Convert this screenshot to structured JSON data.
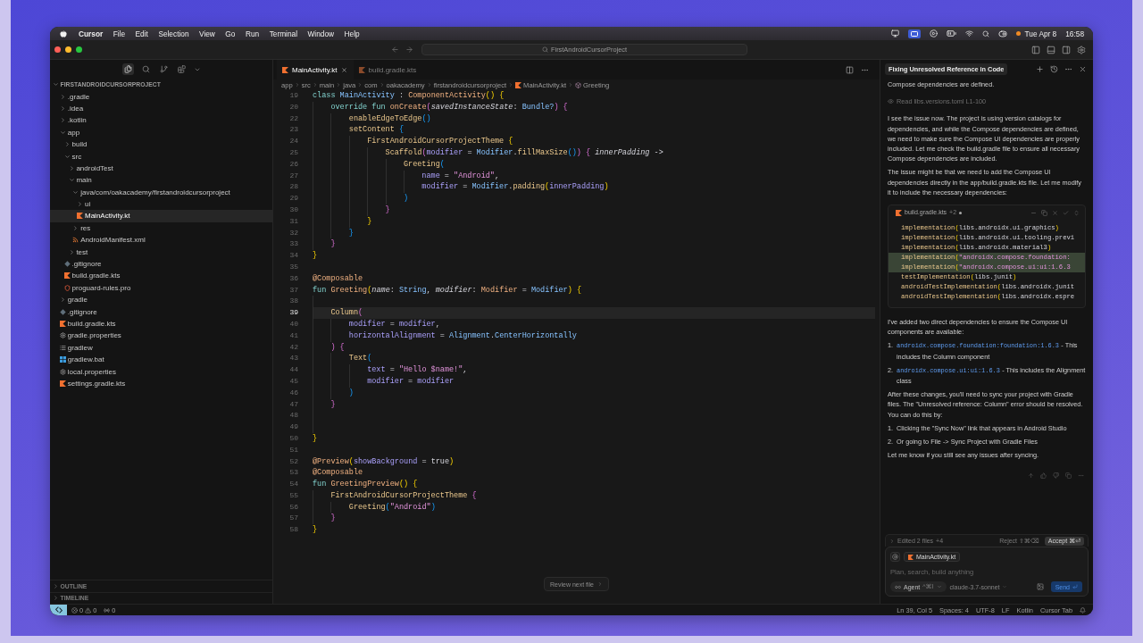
{
  "menu_bar": {
    "app_name": "Cursor",
    "menus": [
      "File",
      "Edit",
      "Selection",
      "View",
      "Go",
      "Run",
      "Terminal",
      "Window",
      "Help"
    ],
    "date": "Tue Apr 8",
    "time": "16:58"
  },
  "title_bar": {
    "command_center": "FirstAndroidCursorProject"
  },
  "sidebar": {
    "views": [
      {
        "kind": "explorer",
        "selected": true
      },
      {
        "kind": "search",
        "selected": false
      },
      {
        "kind": "source-control",
        "selected": false
      },
      {
        "kind": "extensions",
        "selected": false
      }
    ],
    "explorer": {
      "label": "FIRSTANDROIDCURSORPROJECT",
      "expanded": true,
      "children": [
        {
          "label": ".gradle",
          "kind": "folder",
          "expanded": false,
          "selected": false
        },
        {
          "label": ".idea",
          "kind": "folder",
          "expanded": false,
          "selected": false
        },
        {
          "label": ".kotlin",
          "kind": "folder",
          "expanded": false,
          "selected": false
        },
        {
          "label": "app",
          "kind": "folder",
          "expanded": true,
          "selected": false,
          "children": [
            {
              "label": "build",
              "kind": "folder",
              "expanded": false,
              "selected": false
            },
            {
              "label": "src",
              "kind": "folder",
              "expanded": true,
              "selected": false,
              "children": [
                {
                  "label": "androidTest",
                  "kind": "folder",
                  "expanded": false,
                  "selected": false
                },
                {
                  "label": "main",
                  "kind": "folder",
                  "expanded": true,
                  "selected": false,
                  "children": [
                    {
                      "label": "java/com/oakacademy/firstandroidcursorproject",
                      "kind": "folder",
                      "expanded": true,
                      "selected": false,
                      "children": [
                        {
                          "label": "ui",
                          "kind": "folder",
                          "expanded": false,
                          "selected": false
                        },
                        {
                          "label": "MainActivity.kt",
                          "kind": "kotlin",
                          "selected": true
                        }
                      ]
                    },
                    {
                      "label": "res",
                      "kind": "folder",
                      "expanded": false,
                      "selected": false
                    },
                    {
                      "label": "AndroidManifest.xml",
                      "kind": "xml",
                      "selected": false
                    }
                  ]
                },
                {
                  "label": "test",
                  "kind": "folder",
                  "expanded": false,
                  "selected": false
                }
              ]
            },
            {
              "label": ".gitignore",
              "kind": "git",
              "selected": false
            },
            {
              "label": "build.gradle.kts",
              "kind": "kotlin",
              "selected": false
            },
            {
              "label": "proguard-rules.pro",
              "kind": "proguard",
              "selected": false
            }
          ]
        },
        {
          "label": "gradle",
          "kind": "folder",
          "expanded": false,
          "selected": false
        },
        {
          "label": ".gitignore",
          "kind": "git",
          "selected": false
        },
        {
          "label": "build.gradle.kts",
          "kind": "kotlin",
          "selected": false
        },
        {
          "label": "gradle.properties",
          "kind": "properties",
          "selected": false
        },
        {
          "label": "gradlew",
          "kind": "script",
          "selected": false
        },
        {
          "label": "gradlew.bat",
          "kind": "batch",
          "selected": false
        },
        {
          "label": "local.properties",
          "kind": "properties",
          "selected": false
        },
        {
          "label": "settings.gradle.kts",
          "kind": "kotlin",
          "selected": false
        }
      ]
    },
    "sections": [
      {
        "label": "OUTLINE",
        "expanded": false
      },
      {
        "label": "TIMELINE",
        "expanded": false
      }
    ]
  },
  "editor": {
    "tabs": [
      {
        "label": "MainActivity.kt",
        "selected": true
      },
      {
        "label": "build.gradle.kts",
        "selected": false
      }
    ],
    "breadcrumb": [
      {
        "label": "app",
        "kind": "folder"
      },
      {
        "label": "src",
        "kind": "folder"
      },
      {
        "label": "main",
        "kind": "folder"
      },
      {
        "label": "java",
        "kind": "folder"
      },
      {
        "label": "com",
        "kind": "folder"
      },
      {
        "label": "oakacademy",
        "kind": "folder"
      },
      {
        "label": "firstandroidcursorproject",
        "kind": "folder"
      },
      {
        "label": "MainActivity.kt",
        "kind": "kotlin"
      },
      {
        "label": "Greeting",
        "kind": "symbol"
      }
    ],
    "lines": [
      {
        "number": "19",
        "current": false,
        "tokens": [
          {
            "text": "class ",
            "kind": "keyword"
          },
          {
            "text": "MainActivity",
            "kind": "type"
          },
          {
            "text": " : ",
            "kind": "plain"
          },
          {
            "text": "ComponentActivity",
            "kind": "function"
          },
          {
            "text": "() {",
            "kind": "bracket1"
          }
        ]
      },
      {
        "number": "20",
        "current": false,
        "tokens": [
          {
            "text": "    override fun ",
            "kind": "keyword"
          },
          {
            "text": "onCreate",
            "kind": "function"
          },
          {
            "text": "(",
            "kind": "bracket2"
          },
          {
            "text": "savedInstanceState",
            "kind": "italic"
          },
          {
            "text": ": ",
            "kind": "plain"
          },
          {
            "text": "Bundle?",
            "kind": "type"
          },
          {
            "text": ") {",
            "kind": "bracket2"
          }
        ]
      },
      {
        "number": "22",
        "current": false,
        "tokens": [
          {
            "text": "        enableEdgeToEdge",
            "kind": "call"
          },
          {
            "text": "()",
            "kind": "bracket3"
          }
        ]
      },
      {
        "number": "23",
        "current": false,
        "tokens": [
          {
            "text": "        setContent ",
            "kind": "call"
          },
          {
            "text": "{",
            "kind": "bracket3"
          }
        ]
      },
      {
        "number": "24",
        "current": false,
        "tokens": [
          {
            "text": "            FirstAndroidCursorProjectTheme ",
            "kind": "call"
          },
          {
            "text": "{",
            "kind": "bracket1"
          }
        ]
      },
      {
        "number": "25",
        "current": false,
        "tokens": [
          {
            "text": "                Scaffold",
            "kind": "call"
          },
          {
            "text": "(",
            "kind": "bracket2"
          },
          {
            "text": "modifier",
            "kind": "param"
          },
          {
            "text": " = ",
            "kind": "plain"
          },
          {
            "text": "Modifier",
            "kind": "type"
          },
          {
            "text": ".",
            "kind": "plain"
          },
          {
            "text": "fillMaxSize",
            "kind": "call"
          },
          {
            "text": "()",
            "kind": "bracket3"
          },
          {
            "text": ") {",
            "kind": "bracket2"
          },
          {
            "text": " innerPadding",
            "kind": "italic"
          },
          {
            "text": " ->",
            "kind": "plain"
          }
        ]
      },
      {
        "number": "26",
        "current": false,
        "tokens": [
          {
            "text": "                    Greeting",
            "kind": "call"
          },
          {
            "text": "(",
            "kind": "bracket3"
          }
        ]
      },
      {
        "number": "27",
        "current": false,
        "tokens": [
          {
            "text": "                        name",
            "kind": "param"
          },
          {
            "text": " = ",
            "kind": "plain"
          },
          {
            "text": "\"Android\"",
            "kind": "string"
          },
          {
            "text": ",",
            "kind": "plain"
          }
        ]
      },
      {
        "number": "28",
        "current": false,
        "tokens": [
          {
            "text": "                        modifier",
            "kind": "param"
          },
          {
            "text": " = ",
            "kind": "plain"
          },
          {
            "text": "Modifier",
            "kind": "type"
          },
          {
            "text": ".",
            "kind": "plain"
          },
          {
            "text": "padding",
            "kind": "call"
          },
          {
            "text": "(",
            "kind": "bracket1"
          },
          {
            "text": "innerPadding",
            "kind": "param"
          },
          {
            "text": ")",
            "kind": "bracket1"
          }
        ]
      },
      {
        "number": "29",
        "current": false,
        "tokens": [
          {
            "text": "                    )",
            "kind": "bracket3"
          }
        ]
      },
      {
        "number": "30",
        "current": false,
        "tokens": [
          {
            "text": "                }",
            "kind": "bracket2"
          }
        ]
      },
      {
        "number": "31",
        "current": false,
        "tokens": [
          {
            "text": "            }",
            "kind": "bracket1"
          }
        ]
      },
      {
        "number": "32",
        "current": false,
        "tokens": [
          {
            "text": "        }",
            "kind": "bracket3"
          }
        ]
      },
      {
        "number": "33",
        "current": false,
        "tokens": [
          {
            "text": "    }",
            "kind": "bracket2"
          }
        ]
      },
      {
        "number": "34",
        "current": false,
        "tokens": [
          {
            "text": "}",
            "kind": "bracket1"
          }
        ]
      },
      {
        "number": "35",
        "current": false
      },
      {
        "number": "36",
        "current": false,
        "tokens": [
          {
            "text": "@Composable",
            "kind": "annotation"
          }
        ]
      },
      {
        "number": "37",
        "current": false,
        "tokens": [
          {
            "text": "fun ",
            "kind": "keyword"
          },
          {
            "text": "Greeting",
            "kind": "function"
          },
          {
            "text": "(",
            "kind": "bracket1"
          },
          {
            "text": "name",
            "kind": "italic"
          },
          {
            "text": ": ",
            "kind": "plain"
          },
          {
            "text": "String",
            "kind": "type"
          },
          {
            "text": ", ",
            "kind": "plain"
          },
          {
            "text": "modifier",
            "kind": "italic"
          },
          {
            "text": ": ",
            "kind": "plain"
          },
          {
            "text": "Modifier",
            "kind": "function"
          },
          {
            "text": " = ",
            "kind": "plain"
          },
          {
            "text": "Modifier",
            "kind": "type"
          },
          {
            "text": ") {",
            "kind": "bracket1"
          }
        ]
      },
      {
        "number": "38",
        "current": false
      },
      {
        "number": "39",
        "current": true,
        "tokens": [
          {
            "text": "    Column",
            "kind": "call"
          },
          {
            "text": "(",
            "kind": "bracket2"
          }
        ]
      },
      {
        "number": "40",
        "current": false,
        "tokens": [
          {
            "text": "        modifier",
            "kind": "param"
          },
          {
            "text": " = ",
            "kind": "plain"
          },
          {
            "text": "modifier",
            "kind": "param"
          },
          {
            "text": ",",
            "kind": "plain"
          }
        ]
      },
      {
        "number": "41",
        "current": false,
        "tokens": [
          {
            "text": "        horizontalAlignment",
            "kind": "param"
          },
          {
            "text": " = ",
            "kind": "plain"
          },
          {
            "text": "Alignment",
            "kind": "type"
          },
          {
            "text": ".",
            "kind": "plain"
          },
          {
            "text": "CenterHorizontally",
            "kind": "type"
          }
        ]
      },
      {
        "number": "42",
        "current": false,
        "tokens": [
          {
            "text": "    ) {",
            "kind": "bracket2"
          }
        ]
      },
      {
        "number": "43",
        "current": false,
        "tokens": [
          {
            "text": "        Text",
            "kind": "call"
          },
          {
            "text": "(",
            "kind": "bracket3"
          }
        ]
      },
      {
        "number": "44",
        "current": false,
        "tokens": [
          {
            "text": "            text",
            "kind": "param"
          },
          {
            "text": " = ",
            "kind": "plain"
          },
          {
            "text": "\"Hello $name!\"",
            "kind": "string"
          },
          {
            "text": ",",
            "kind": "plain"
          }
        ]
      },
      {
        "number": "45",
        "current": false,
        "tokens": [
          {
            "text": "            modifier",
            "kind": "param"
          },
          {
            "text": " = ",
            "kind": "plain"
          },
          {
            "text": "modifier",
            "kind": "param"
          }
        ]
      },
      {
        "number": "46",
        "current": false,
        "tokens": [
          {
            "text": "        )",
            "kind": "bracket3"
          }
        ]
      },
      {
        "number": "47",
        "current": false,
        "tokens": [
          {
            "text": "    }",
            "kind": "bracket2"
          }
        ]
      },
      {
        "number": "48",
        "current": false
      },
      {
        "number": "49",
        "current": false
      },
      {
        "number": "50",
        "current": false,
        "tokens": [
          {
            "text": "}",
            "kind": "bracket1"
          }
        ]
      },
      {
        "number": "51",
        "current": false
      },
      {
        "number": "52",
        "current": false,
        "tokens": [
          {
            "text": "@Preview",
            "kind": "annotation"
          },
          {
            "text": "(",
            "kind": "bracket1"
          },
          {
            "text": "showBackground",
            "kind": "param"
          },
          {
            "text": " = ",
            "kind": "plain"
          },
          {
            "text": "true",
            "kind": "plain"
          },
          {
            "text": ")",
            "kind": "bracket1"
          }
        ]
      },
      {
        "number": "53",
        "current": false,
        "tokens": [
          {
            "text": "@Composable",
            "kind": "annotation"
          }
        ]
      },
      {
        "number": "54",
        "current": false,
        "tokens": [
          {
            "text": "fun ",
            "kind": "keyword"
          },
          {
            "text": "GreetingPreview",
            "kind": "function"
          },
          {
            "text": "() {",
            "kind": "bracket1"
          }
        ]
      },
      {
        "number": "55",
        "current": false,
        "tokens": [
          {
            "text": "    FirstAndroidCursorProjectTheme ",
            "kind": "call"
          },
          {
            "text": "{",
            "kind": "bracket2"
          }
        ]
      },
      {
        "number": "56",
        "current": false,
        "tokens": [
          {
            "text": "        Greeting",
            "kind": "call"
          },
          {
            "text": "(",
            "kind": "bracket3"
          },
          {
            "text": "\"Android\"",
            "kind": "string"
          },
          {
            "text": ")",
            "kind": "bracket3"
          }
        ]
      },
      {
        "number": "57",
        "current": false,
        "tokens": [
          {
            "text": "    }",
            "kind": "bracket2"
          }
        ]
      },
      {
        "number": "58",
        "current": false,
        "tokens": [
          {
            "text": "}",
            "kind": "bracket1"
          }
        ]
      }
    ],
    "review_button": "Review next file"
  },
  "chat": {
    "title": "Fixing Unresolved Reference in Code",
    "blocks": [
      {
        "kind": "paragraph",
        "text": "Compose dependencies are defined."
      },
      {
        "kind": "tool",
        "text": "Read libs.versions.toml L1-100"
      },
      {
        "kind": "paragraph",
        "text": "I see the issue now. The project is using version catalogs for dependencies, and while the Compose dependencies are defined, we need to make sure the Compose UI dependencies are properly included. Let me check the build.gradle file to ensure all necessary Compose dependencies are included."
      },
      {
        "kind": "paragraph",
        "text": "The issue might be that we need to add the Compose UI dependencies directly in the app/build.gradle.kts file. Let me modify it to include the necessary dependencies:"
      },
      {
        "kind": "code",
        "file": "build.gradle.kts",
        "changes": "+2",
        "unsaved": true,
        "lines": [
          {
            "added": false,
            "tokens": [
              {
                "text": "implementation",
                "kind": "call"
              },
              {
                "text": "(",
                "kind": "bracket1"
              },
              {
                "text": "libs.androidx.ui.graphics",
                "kind": "plain"
              },
              {
                "text": ")",
                "kind": "bracket1"
              }
            ]
          },
          {
            "added": false,
            "tokens": [
              {
                "text": "implementation",
                "kind": "call"
              },
              {
                "text": "(",
                "kind": "bracket1"
              },
              {
                "text": "libs.androidx.ui.tooling.previ",
                "kind": "plain"
              }
            ]
          },
          {
            "added": false,
            "tokens": [
              {
                "text": "implementation",
                "kind": "call"
              },
              {
                "text": "(",
                "kind": "bracket1"
              },
              {
                "text": "libs.androidx.material3",
                "kind": "plain"
              },
              {
                "text": ")",
                "kind": "bracket1"
              }
            ]
          },
          {
            "added": true,
            "tokens": [
              {
                "text": "implementation",
                "kind": "call"
              },
              {
                "text": "(",
                "kind": "bracket1"
              },
              {
                "text": "\"androidx.compose.foundation:",
                "kind": "string"
              }
            ]
          },
          {
            "added": true,
            "tokens": [
              {
                "text": "implementation",
                "kind": "call"
              },
              {
                "text": "(",
                "kind": "bracket1"
              },
              {
                "text": "\"androidx.compose.ui:ui:1.6.3",
                "kind": "string"
              }
            ]
          },
          {
            "added": false,
            "tokens": [
              {
                "text": "testImplementation",
                "kind": "call"
              },
              {
                "text": "(",
                "kind": "bracket1"
              },
              {
                "text": "libs.junit",
                "kind": "plain"
              },
              {
                "text": ")",
                "kind": "bracket1"
              }
            ]
          },
          {
            "added": false,
            "tokens": [
              {
                "text": "androidTestImplementation",
                "kind": "call"
              },
              {
                "text": "(",
                "kind": "bracket1"
              },
              {
                "text": "libs.androidx.junit",
                "kind": "plain"
              }
            ]
          },
          {
            "added": false,
            "tokens": [
              {
                "text": "androidTestImplementation",
                "kind": "call"
              },
              {
                "text": "(",
                "kind": "bracket1"
              },
              {
                "text": "libs.androidx.espre",
                "kind": "plain"
              }
            ]
          }
        ]
      },
      {
        "kind": "paragraph",
        "text": "I've added two direct dependencies to ensure the Compose UI components are available:"
      },
      {
        "kind": "list",
        "items": [
          {
            "number": "1.",
            "code": "androidx.compose.foundation:foundation:1.6.3",
            "text": "- This includes the Column component"
          },
          {
            "number": "2.",
            "code": "androidx.compose.ui:ui:1.6.3",
            "text": "- This includes the Alignment class"
          }
        ]
      },
      {
        "kind": "paragraph",
        "text": "After these changes, you'll need to sync your project with Gradle files. The \"Unresolved reference: Column\" error should be resolved. You can do this by:"
      },
      {
        "kind": "list",
        "items": [
          {
            "number": "1.",
            "text": "Clicking the \"Sync Now\" link that appears in Android Studio"
          },
          {
            "number": "2.",
            "text": "Or going to File -> Sync Project with Gradle Files"
          }
        ]
      },
      {
        "kind": "paragraph",
        "text": "Let me know if you still see any issues after syncing."
      }
    ],
    "edits": {
      "label": "Edited 2 files",
      "count": "+4",
      "expanded": false,
      "reject": "Reject",
      "reject_shortcut": "⇧⌘⌫",
      "accept": "Accept",
      "accept_shortcut": "⌘⏎"
    },
    "composer": {
      "file_chip": "MainActivity.kt",
      "placeholder": "Plan, search, build anything",
      "mode": "Agent",
      "mode_shortcut": "^⌘I",
      "model": "claude-3.7-sonnet",
      "send": "Send"
    }
  },
  "status_bar": {
    "errors": "0",
    "warnings": "0",
    "ports": "0",
    "items": [
      "Ln 39, Col 5",
      "Spaces: 4",
      "UTF-8",
      "LF",
      "Kotlin",
      "Cursor Tab"
    ]
  }
}
